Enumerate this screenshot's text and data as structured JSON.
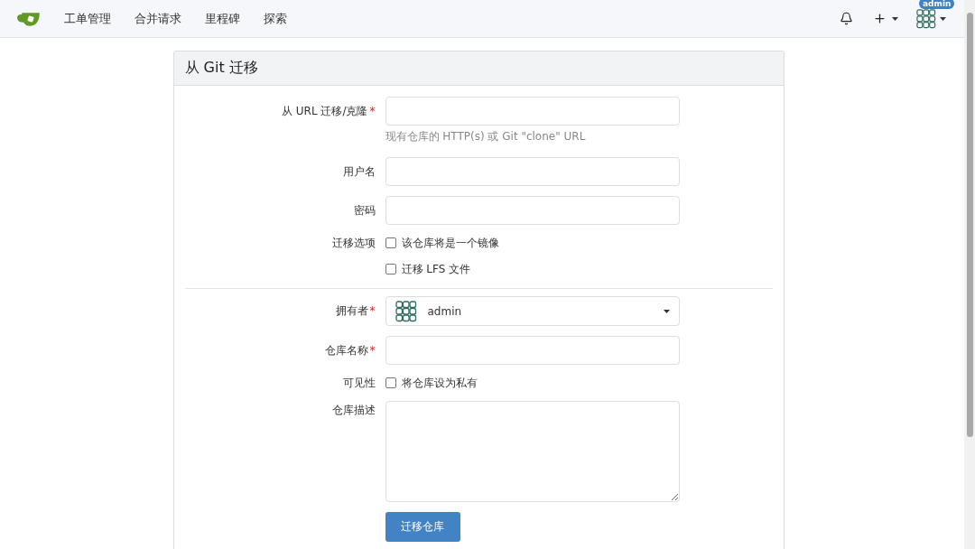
{
  "nav": {
    "items": [
      {
        "label": "工单管理"
      },
      {
        "label": "合并请求"
      },
      {
        "label": "里程碑"
      },
      {
        "label": "探索"
      }
    ],
    "user_badge": "admin"
  },
  "panel": {
    "title": "从 Git 迁移",
    "rows": [
      {
        "kind": "input",
        "label": "从 URL 迁移/克隆",
        "required_mark": "*",
        "help": "现有仓库的 HTTP(s) 或 Git \"clone\" URL"
      },
      {
        "kind": "input",
        "label": "用户名"
      },
      {
        "kind": "input",
        "label": "密码"
      },
      {
        "kind": "checks",
        "label": "迁移选项",
        "options": [
          {
            "text": "该仓库将是一个镜像",
            "checked": false
          },
          {
            "text": "迁移 LFS 文件",
            "checked": false
          }
        ]
      },
      {
        "kind": "divider"
      },
      {
        "kind": "select",
        "label": "拥有者",
        "required_mark": "*",
        "value": "admin"
      },
      {
        "kind": "input",
        "label": "仓库名称",
        "required_mark": "*"
      },
      {
        "kind": "checks",
        "label": "可见性",
        "options": [
          {
            "text": "将仓库设为私有",
            "checked": false
          }
        ]
      },
      {
        "kind": "textarea",
        "label": "仓库描述"
      }
    ],
    "submit": "迁移仓库"
  }
}
